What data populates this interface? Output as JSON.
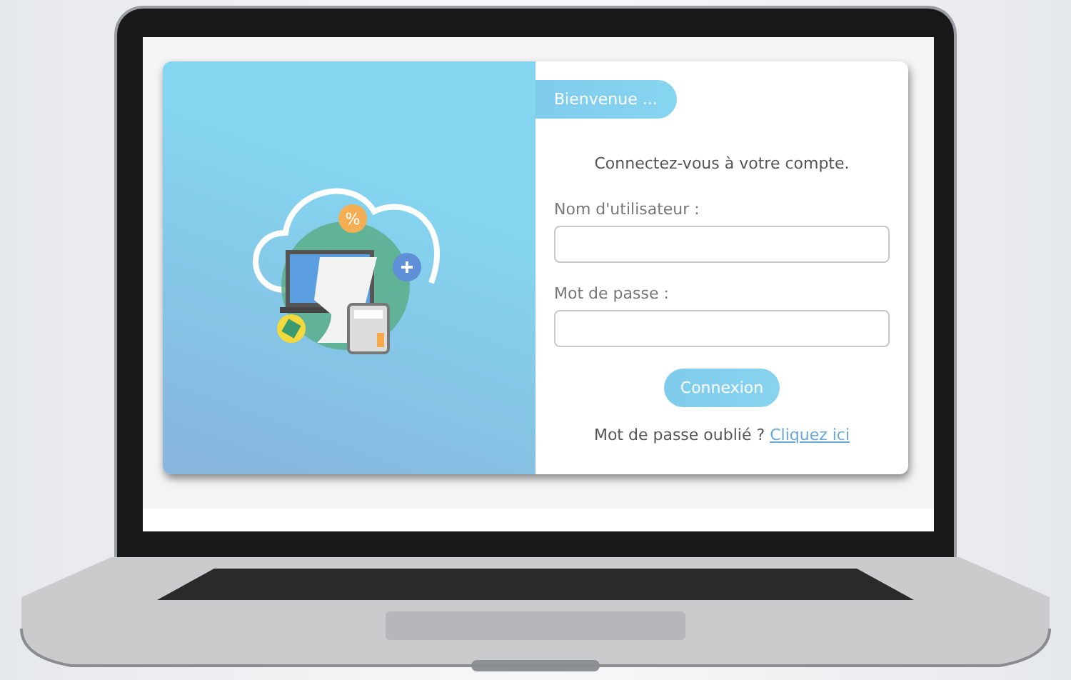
{
  "welcome": "Bienvenue ...",
  "heading": "Connectez-vous à votre compte.",
  "illustration": {
    "badge": "%"
  },
  "fields": [
    {
      "label": "Nom d'utilisateur :"
    },
    {
      "label": "Mot de passe :"
    }
  ],
  "submit": "Connexion",
  "forgot": {
    "text": "Mot de passe oublié ?",
    "link": "Cliquez ici"
  }
}
